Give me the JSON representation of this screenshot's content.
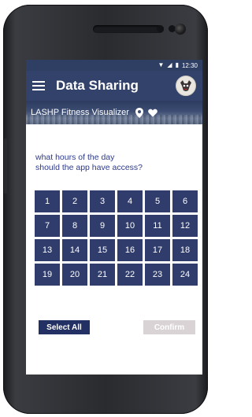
{
  "status": {
    "time": "12:30",
    "wifi_icon": "wifi-icon",
    "signal_icon": "signal-icon",
    "battery_icon": "battery-icon"
  },
  "appbar": {
    "title": "Data Sharing",
    "menu_icon": "hamburger-menu-icon",
    "avatar_icon": "user-avatar"
  },
  "subbar": {
    "title": "LASHP Fitness Visualizer",
    "icons": [
      "location-pin-icon",
      "heart-icon"
    ]
  },
  "question": {
    "line1": "what hours of the day",
    "line2": "should the app have access?"
  },
  "hours": [
    "1",
    "2",
    "3",
    "4",
    "5",
    "6",
    "7",
    "8",
    "9",
    "10",
    "11",
    "12",
    "13",
    "14",
    "15",
    "16",
    "17",
    "18",
    "19",
    "20",
    "21",
    "22",
    "23",
    "24"
  ],
  "buttons": {
    "select_all": "Select All",
    "confirm": "Confirm"
  },
  "colors": {
    "primary": "#33426a",
    "cell": "#2f3c6c",
    "question_text": "#2d3a8a",
    "confirm_disabled": "#d9d3d6"
  }
}
